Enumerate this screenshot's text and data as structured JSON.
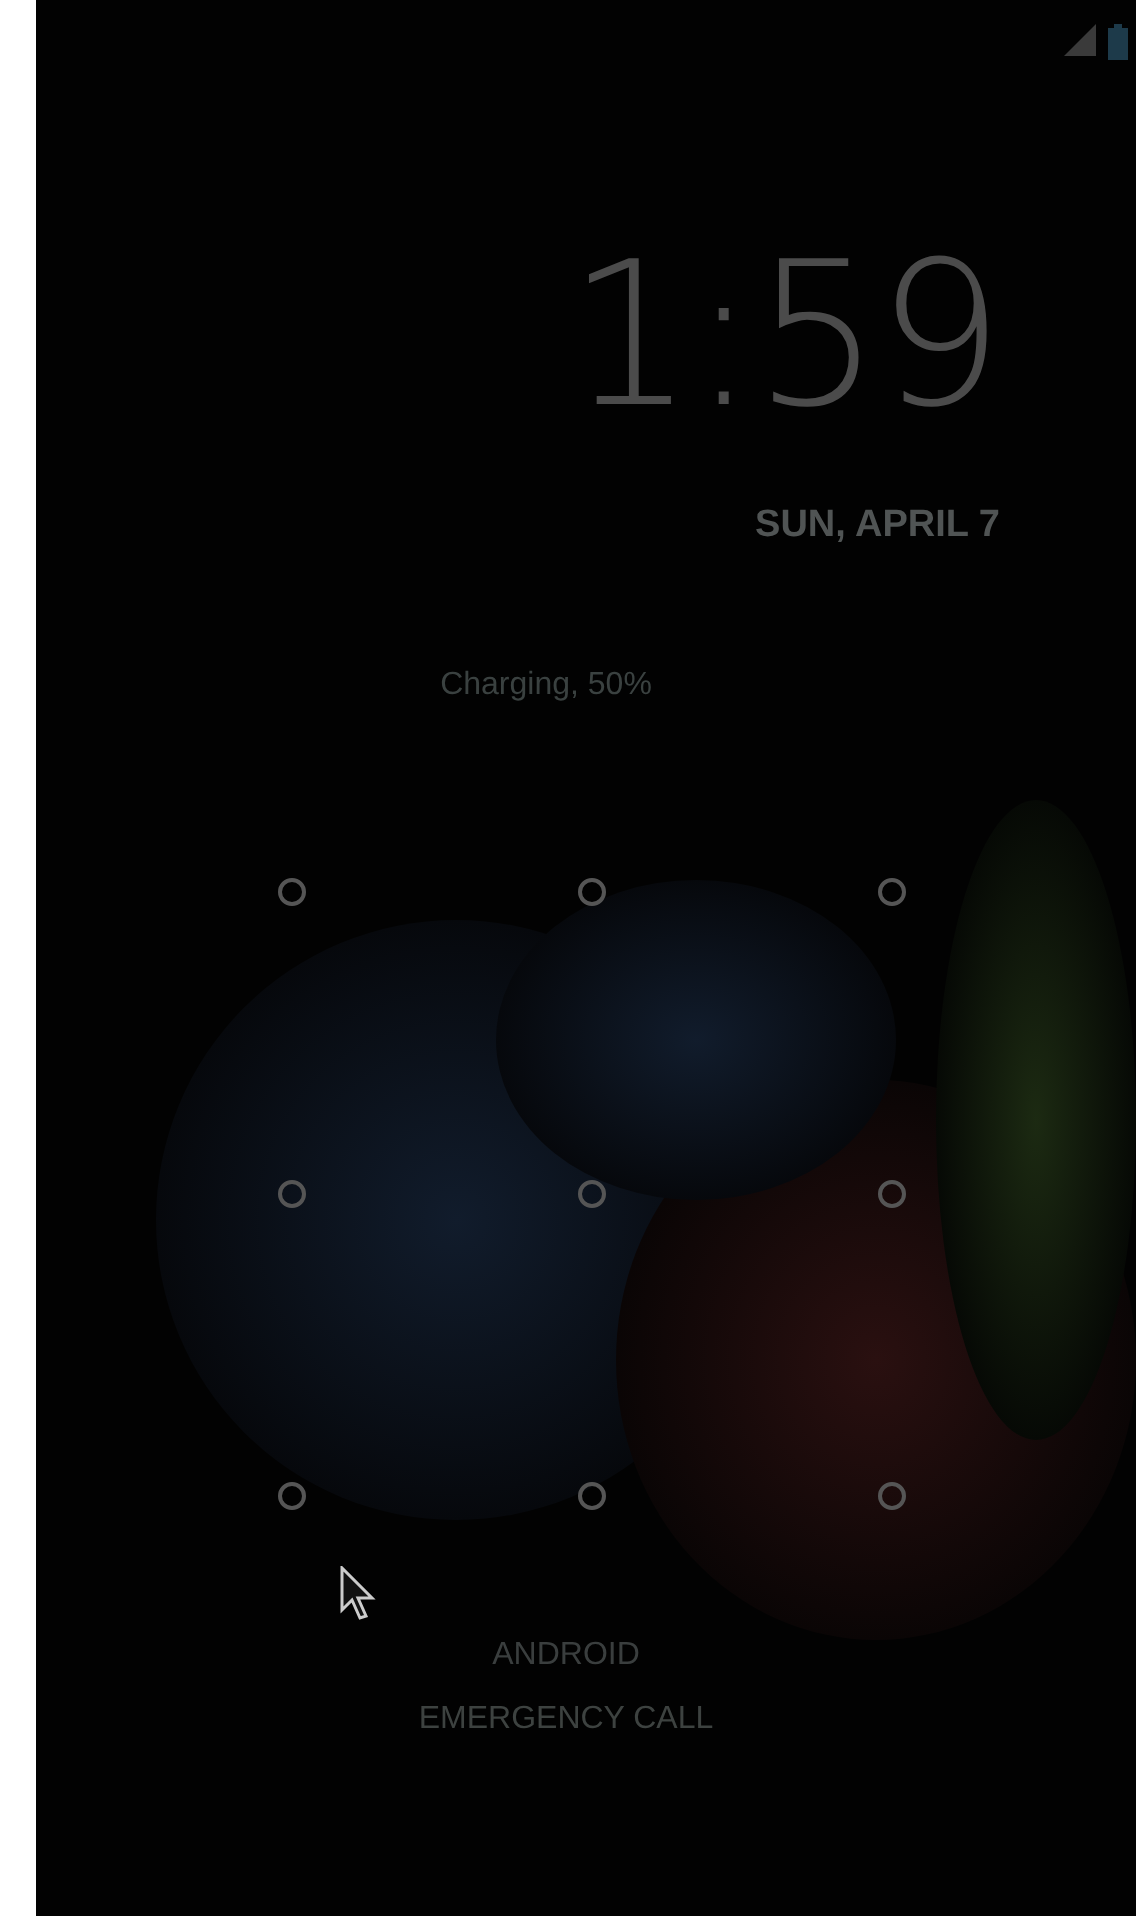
{
  "clock": {
    "time": "1:59",
    "date": "SUN, APRIL 7"
  },
  "status": "Charging, 50%",
  "pattern": {
    "dots": [
      {
        "selected": false
      },
      {
        "selected": false
      },
      {
        "selected": false
      },
      {
        "selected": false
      },
      {
        "selected": false
      },
      {
        "selected": false
      },
      {
        "selected": false
      },
      {
        "selected": false
      },
      {
        "selected": false
      }
    ]
  },
  "carrier": "ANDROID",
  "emergency_button": "EMERGENCY CALL"
}
